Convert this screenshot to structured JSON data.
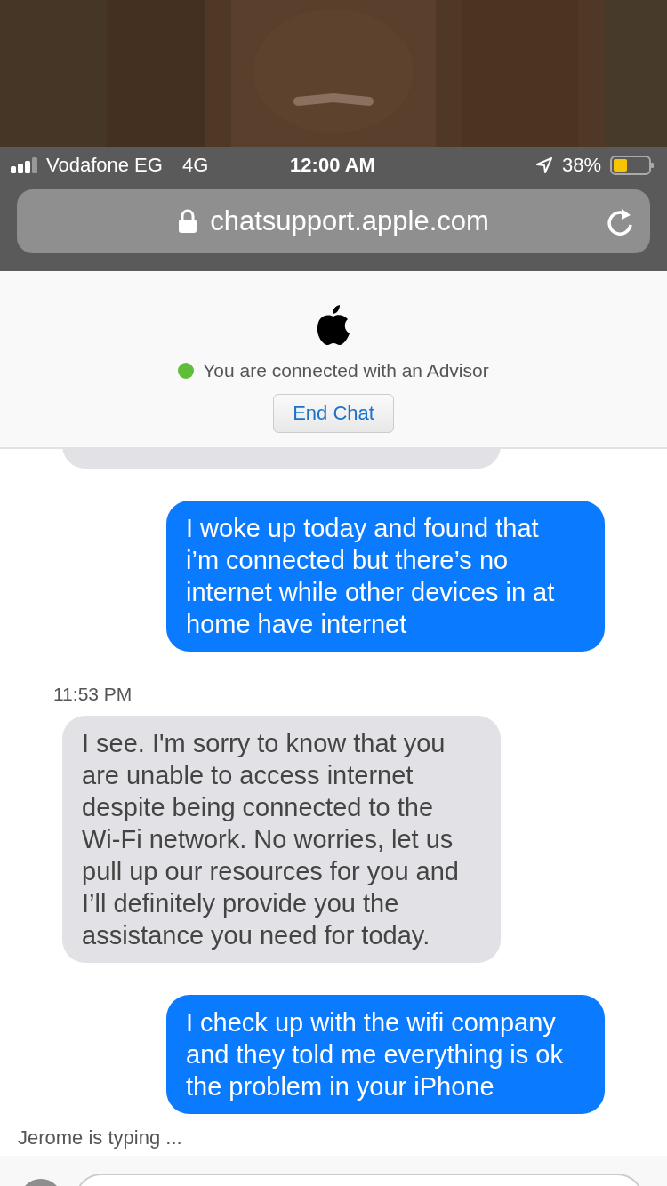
{
  "status_bar": {
    "carrier": "Vodafone EG",
    "network": "4G",
    "time": "12:00 AM",
    "battery": "38%"
  },
  "address_bar": {
    "url": "chatsupport.apple.com"
  },
  "header": {
    "status": "You are connected with an Advisor",
    "end_button": "End Chat"
  },
  "messages": [
    {
      "kind": "received",
      "partial": true
    },
    {
      "kind": "sent",
      "text": "I woke up today and found that i’m connected but there’s no internet while other devices in at home have internet"
    },
    {
      "kind": "received",
      "timestamp": "11:53 PM",
      "text": "I see. I'm sorry to know that you are unable to access internet despite being connected to the Wi-Fi network. No worries, let us pull up our resources for you and I’ll definitely provide you the assistance you need for today."
    },
    {
      "kind": "sent",
      "text": "I check up with the wifi company and they told me everything is ok the problem in your iPhone"
    }
  ],
  "typing": "Jerome is typing ..."
}
